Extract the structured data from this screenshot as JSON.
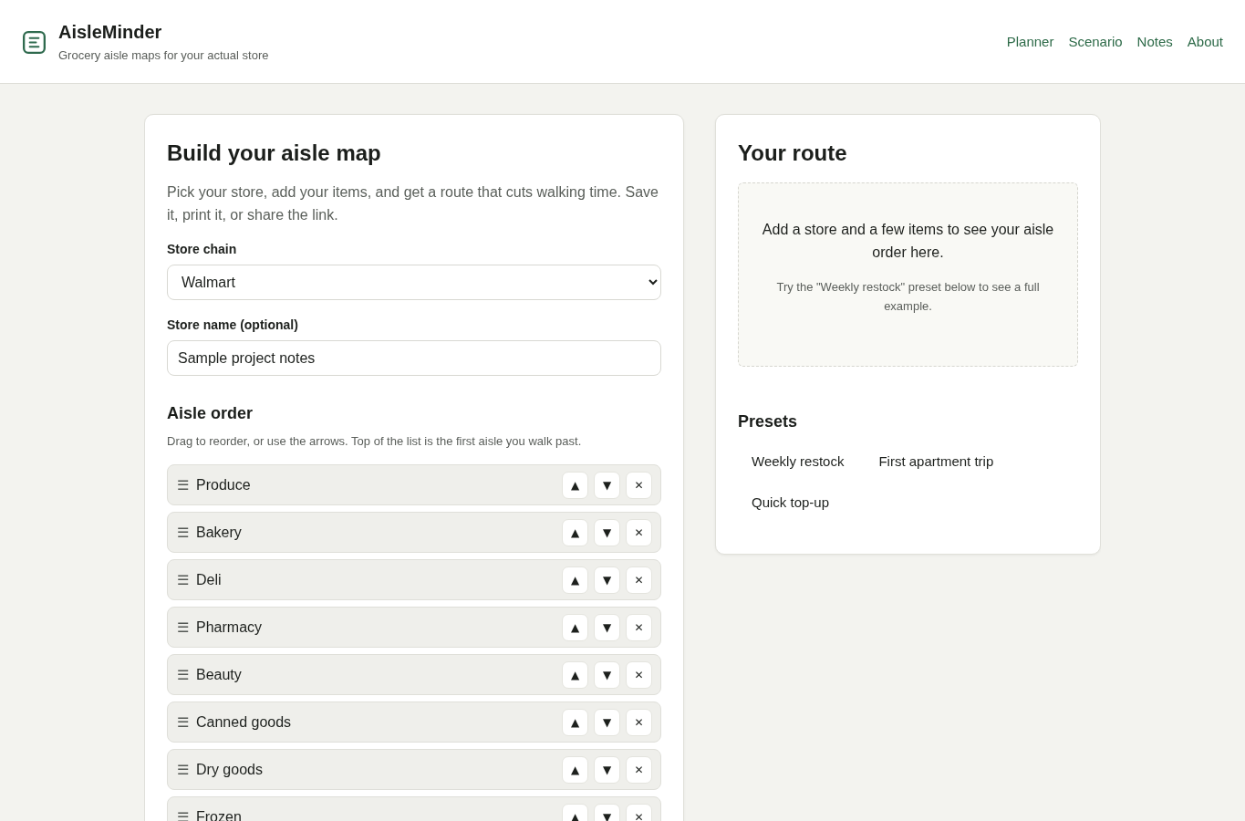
{
  "header": {
    "title": "AisleMinder",
    "subtitle": "Grocery aisle maps for your actual store",
    "nav": [
      "Planner",
      "Scenario",
      "Notes",
      "About"
    ]
  },
  "builder": {
    "title": "Build your aisle map",
    "intro": "Pick your store, add your items, and get a route that cuts walking time. Save it, print it, or share the link.",
    "fields": [
      {
        "kind": "select",
        "label": "Store chain",
        "value": "Walmart"
      },
      {
        "kind": "text",
        "label": "Store name (optional)",
        "value": "Sample project notes"
      }
    ],
    "aisle_order": {
      "title": "Aisle order",
      "hint": "Drag to reorder, or use the arrows. Top of the list is the first aisle you walk past.",
      "aisles": [
        {
          "handle": "☰",
          "name": "Produce",
          "controls": [
            "▲",
            "▼",
            "✕"
          ]
        },
        {
          "handle": "☰",
          "name": "Bakery",
          "controls": [
            "▲",
            "▼",
            "✕"
          ]
        },
        {
          "handle": "☰",
          "name": "Deli",
          "controls": [
            "▲",
            "▼",
            "✕"
          ]
        },
        {
          "handle": "☰",
          "name": "Pharmacy",
          "controls": [
            "▲",
            "▼",
            "✕"
          ]
        },
        {
          "handle": "☰",
          "name": "Beauty",
          "controls": [
            "▲",
            "▼",
            "✕"
          ]
        },
        {
          "handle": "☰",
          "name": "Canned goods",
          "controls": [
            "▲",
            "▼",
            "✕"
          ]
        },
        {
          "handle": "☰",
          "name": "Dry goods",
          "controls": [
            "▲",
            "▼",
            "✕"
          ]
        },
        {
          "handle": "☰",
          "name": "Frozen",
          "controls": [
            "▲",
            "▼",
            "✕"
          ]
        }
      ]
    }
  },
  "route": {
    "title": "Your route",
    "empty_state": {
      "message": "Add a store and a few items to see your aisle order here.",
      "hint": "Try the \"Weekly restock\" preset below to see a full example."
    },
    "presets": {
      "title": "Presets",
      "items": [
        "Weekly restock",
        "First apartment trip",
        "Quick top-up"
      ]
    }
  }
}
